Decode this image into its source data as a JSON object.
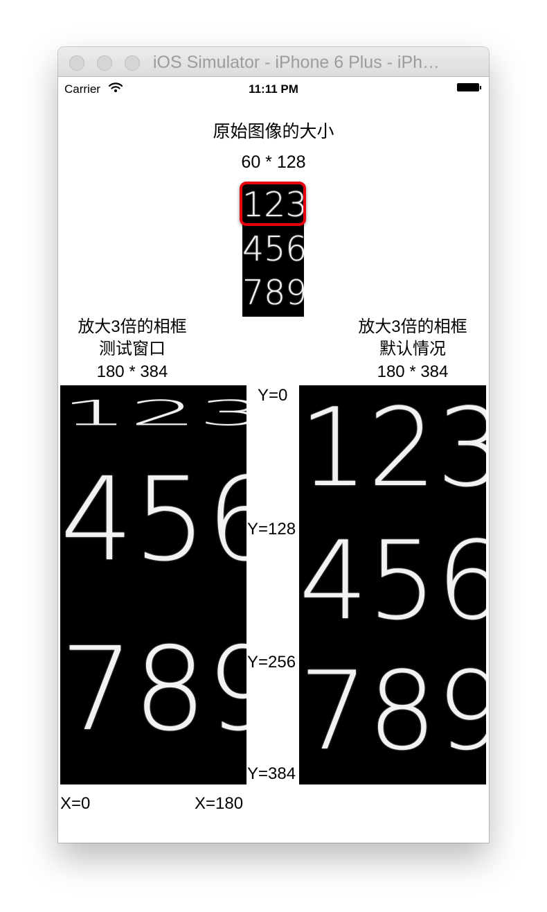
{
  "window": {
    "title": "iOS Simulator - iPhone 6 Plus - iPh…"
  },
  "status_bar": {
    "carrier": "Carrier",
    "time": "11:11 PM"
  },
  "original": {
    "title": "原始图像的大小",
    "size": "60 * 128",
    "rows": [
      "123",
      "456",
      "789"
    ]
  },
  "left_panel": {
    "line1": "放大3倍的相框",
    "line2": "测试窗口",
    "size": "180 * 384",
    "rows": [
      "123",
      "456",
      "789"
    ]
  },
  "right_panel": {
    "line1": "放大3倍的相框",
    "line2": "默认情况",
    "size": "180 * 384",
    "rows": [
      "123",
      "456",
      "789"
    ]
  },
  "y_markers": [
    "Y=0",
    "Y=128",
    "Y=256",
    "Y=384"
  ],
  "x_markers": [
    "X=0",
    "X=180"
  ],
  "colors": {
    "crop_frame": "#e8000c",
    "image_background": "#000000",
    "digit_color": "#f2f2f2"
  }
}
